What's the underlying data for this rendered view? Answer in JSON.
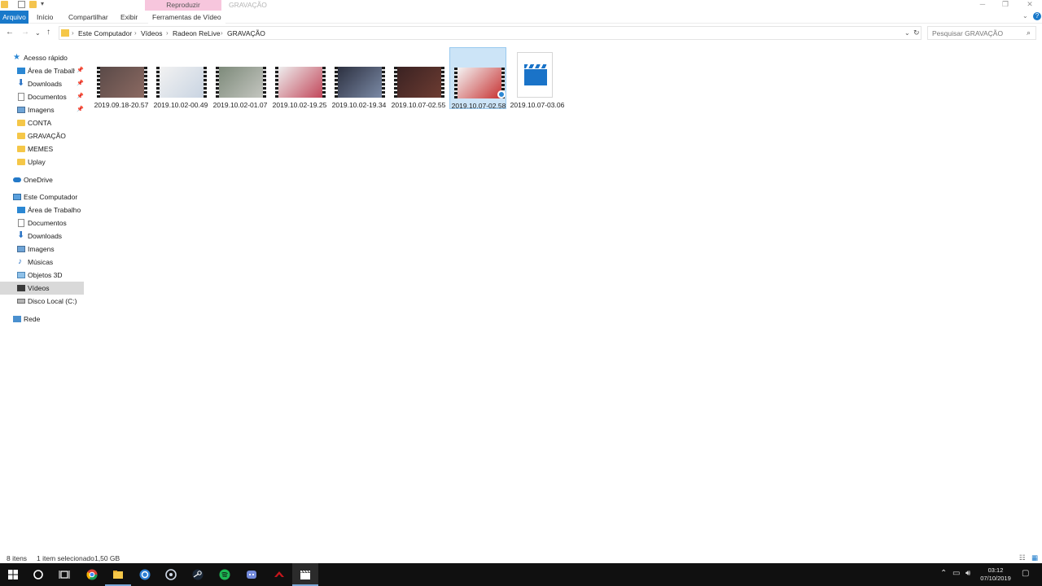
{
  "window": {
    "context_group_label": "Reproduzir",
    "title": "GRAVAÇÃO"
  },
  "ribbon": {
    "tabs": [
      {
        "label": "Arquivo"
      },
      {
        "label": "Início"
      },
      {
        "label": "Compartilhar"
      },
      {
        "label": "Exibir"
      },
      {
        "label": "Ferramentas de Vídeo"
      }
    ]
  },
  "address": {
    "crumbs": [
      "Este Computador",
      "Vídeos",
      "Radeon ReLive",
      "GRAVAÇÃO"
    ],
    "search_placeholder": "Pesquisar GRAVAÇÃO"
  },
  "nav": {
    "quick_access": "Acesso rápido",
    "quick_items": [
      {
        "label": "Área de Trabalho",
        "icon": "desktop-icon",
        "pinned": true
      },
      {
        "label": "Downloads",
        "icon": "download-icon",
        "pinned": true
      },
      {
        "label": "Documentos",
        "icon": "documents-icon",
        "pinned": true
      },
      {
        "label": "Imagens",
        "icon": "images-icon",
        "pinned": true
      },
      {
        "label": "CONTA",
        "icon": "folder-icon"
      },
      {
        "label": "GRAVAÇÃO",
        "icon": "folder-icon"
      },
      {
        "label": "MEMES",
        "icon": "folder-icon"
      },
      {
        "label": "Uplay",
        "icon": "folder-icon"
      }
    ],
    "onedrive": "OneDrive",
    "this_pc": "Este Computador",
    "pc_items": [
      {
        "label": "Área de Trabalho",
        "icon": "desktop-icon"
      },
      {
        "label": "Documentos",
        "icon": "documents-icon"
      },
      {
        "label": "Downloads",
        "icon": "download-icon"
      },
      {
        "label": "Imagens",
        "icon": "images-icon"
      },
      {
        "label": "Músicas",
        "icon": "music-icon"
      },
      {
        "label": "Objetos 3D",
        "icon": "3d-objects-icon"
      },
      {
        "label": "Vídeos",
        "icon": "videos-icon",
        "selected": true
      },
      {
        "label": "Disco Local (C:)",
        "icon": "disk-icon"
      }
    ],
    "network": "Rede"
  },
  "files": [
    {
      "name": "2019.09.18-20.57",
      "colors": [
        "#5a4a48",
        "#8c6a62"
      ]
    },
    {
      "name": "2019.10.02-00.49",
      "colors": [
        "#f2f2f2",
        "#c9d4e2"
      ]
    },
    {
      "name": "2019.10.02-01.07",
      "colors": [
        "#7d8a7a",
        "#c4c6c0"
      ]
    },
    {
      "name": "2019.10.02-19.25",
      "colors": [
        "#eeeeee",
        "#c2475a"
      ]
    },
    {
      "name": "2019.10.02-19.34",
      "colors": [
        "#2c3040",
        "#7b8aa6"
      ]
    },
    {
      "name": "2019.10.07-02.55",
      "colors": [
        "#3a2222",
        "#6d3c32"
      ]
    },
    {
      "name": "2019.10.07-02.58",
      "colors": [
        "#f4f4f4",
        "#c73333"
      ],
      "selected": true
    },
    {
      "name": "2019.10.07-03.06",
      "type": "video-file"
    }
  ],
  "status": {
    "item_count": "8 itens",
    "selection": "1 item selecionado",
    "size": "1,50 GB"
  },
  "taskbar": {
    "time": "03:12",
    "date": "07/10/2019"
  }
}
